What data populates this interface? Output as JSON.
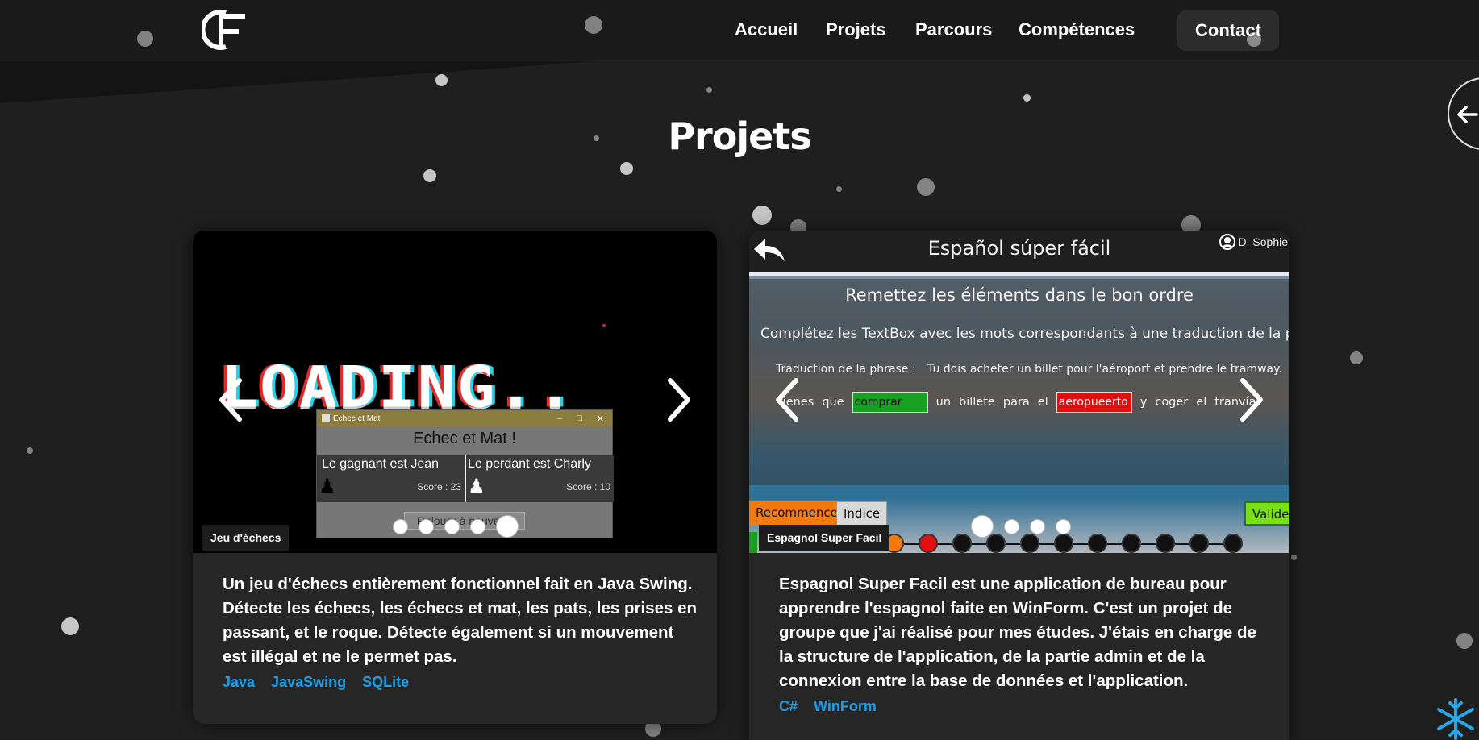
{
  "header": {
    "logo_text": "CF",
    "nav": [
      "Accueil",
      "Projets",
      "Parcours",
      "Compétences"
    ],
    "contact_label": "Contact"
  },
  "page": {
    "title": "Projets"
  },
  "projects": [
    {
      "caption": "Jeu d'échecs",
      "description": "Un jeu d'échecs entièrement fonctionnel fait en Java Swing. Détecte les échecs, les échecs et mat, les pats, les prises en passant, et le roque. Détecte également si un mouvement est illégal et ne le permet pas.",
      "tags": [
        "Java",
        "JavaSwing",
        "SQLite"
      ],
      "carousel": {
        "slides": 5,
        "active_index": 4
      },
      "screenshot": {
        "loading_text": "LOADING..",
        "window_title": "Echec et Mat",
        "heading": "Echec et Mat !",
        "winner": "Le gagnant est Jean",
        "loser": "Le perdant est Charly",
        "winner_score": "Score : 23",
        "loser_score": "Score : 10",
        "replay_button": "Rejouer à nouveau"
      }
    },
    {
      "caption": "Espagnol Super Facil",
      "description": "Espagnol Super Facil est une application de bureau pour apprendre l'espagnol faite en WinForm. C'est un projet de groupe que j'ai réalisé pour mes études. J'étais en charge de la structure de l'application, de la partie admin et de la connexion entre la base de données et l'application.",
      "tags": [
        "C#",
        "WinForm"
      ],
      "carousel": {
        "slides": 4,
        "active_index": 0
      },
      "screenshot": {
        "app_title": "Español súper fácil",
        "user": "D. Sophie",
        "exercise_title": "Remettez les éléments dans le bon ordre",
        "instructions": "Complétez les TextBox avec les mots correspondants à une traduction de la phrase.",
        "translation_label": "Traduction de la phrase :",
        "translation": "Tu dois acheter un billet pour l'aéroport et prendre le tramway.",
        "sentence_words": [
          "tienes",
          "que"
        ],
        "answer_correct": "comprar",
        "sentence_mid": [
          "un",
          "billete",
          "para",
          "el"
        ],
        "answer_wrong": "aeropueerto",
        "sentence_end": [
          "y",
          "coger",
          "el",
          "tranvía"
        ],
        "btn_restart": "Recommencer",
        "btn_hint": "Indice",
        "btn_validate": "Valider",
        "progress_states": [
          "done",
          "error",
          "todo",
          "todo",
          "todo",
          "todo",
          "todo",
          "todo",
          "todo",
          "todo",
          "todo"
        ]
      }
    }
  ],
  "colors": {
    "background": "#1f1f1f",
    "card": "#262626",
    "tag": "#1aa0e8",
    "accent_orange": "#f07a10",
    "correct_green": "#18a020",
    "wrong_red": "#e01010"
  }
}
